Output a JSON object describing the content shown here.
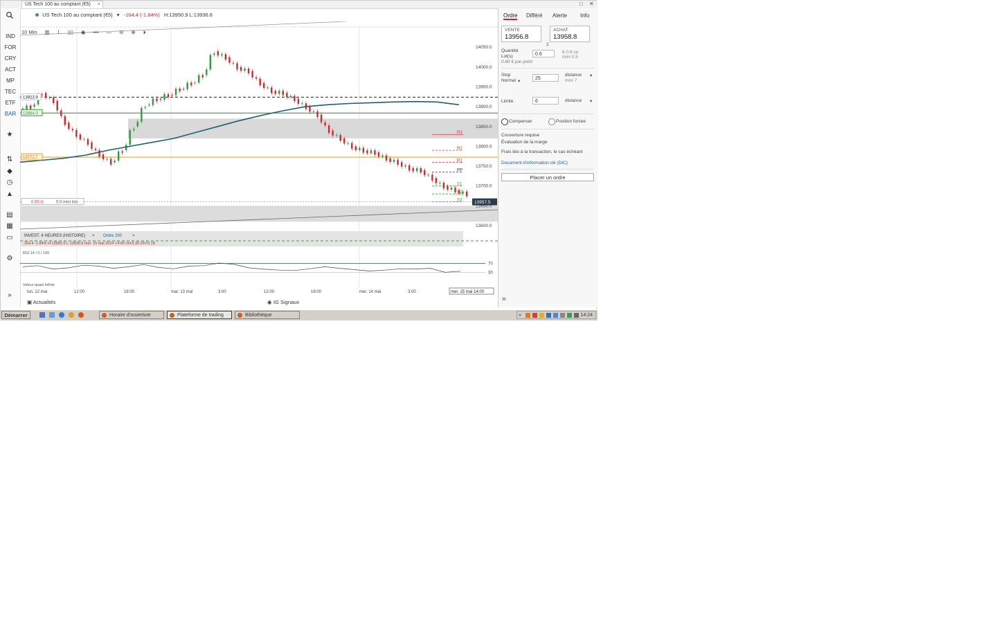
{
  "window": {
    "tab_title": "US Tech 100 au comptant (€5)",
    "tab_close": "×",
    "restore_btn": "□",
    "close_btn": "✕"
  },
  "left_nav": {
    "search_icon": "search-icon",
    "items": [
      "IND",
      "FOR",
      "CRY",
      "ACT",
      "MP",
      "TEC",
      "ETF",
      "BAR"
    ],
    "icons": [
      "star-icon",
      "arrows-icon",
      "tag-icon",
      "history-icon",
      "bell-icon",
      "archive-icon",
      "calculator-icon",
      "calendar-icon",
      "gear-icon",
      "expand-icon"
    ]
  },
  "instrument": {
    "name": "US Tech 100 au comptant (€5)",
    "change": "-164.4 (-1.84%)",
    "hilo": "H:13950.9 L:13936.6"
  },
  "chart_toolbar": {
    "timeframe": "10 Min",
    "items": [
      "10 Min",
      "bars-icon",
      "indicator-icon",
      "eye-icon",
      "more-icon",
      "line-icon",
      "zoom-out-icon",
      "zoom-in-icon",
      "play-icon"
    ]
  },
  "chart_data": [
    {
      "type": "line",
      "title": "US Tech 100 au comptant (€5) — 10 Min",
      "x_ticks": [
        "lun. 12 mai",
        "12:00",
        "18:00",
        "mar. 13 mai",
        "3:00",
        "12:00",
        "18:00",
        "mer. 14 mai",
        "3:00",
        "mer. 15 mai 14:00"
      ],
      "y_ticks": [
        14050.0,
        14000.0,
        13950.0,
        13900.0,
        13850.0,
        13800.0,
        13750.0,
        13700.0,
        13650.0,
        13600.0
      ],
      "ylim": [
        13600,
        14080
      ],
      "price_labels": {
        "upper_black_line": "13923.9",
        "green_line": "13884.0",
        "orange_line": "13772.7",
        "current": "13957.5",
        "bid_input": "0.00 G",
        "order_input": "0.0 mini lots"
      },
      "pivot_labels": [
        "R3",
        "R2",
        "R1",
        "PP",
        "S1",
        "S2",
        "S3"
      ],
      "series": [
        {
          "name": "close",
          "values": [
            13900,
            13935,
            13915,
            13860,
            13830,
            13810,
            13780,
            13760,
            13790,
            13850,
            13905,
            13920,
            13930,
            13945,
            13960,
            13980,
            14040,
            14025,
            14000,
            13990,
            13960,
            13940,
            13935,
            13920,
            13900,
            13880,
            13840,
            13820,
            13800,
            13790,
            13785,
            13770,
            13760,
            13745,
            13740,
            13720,
            13700,
            13690,
            13680
          ]
        },
        {
          "name": "MA 200",
          "values": [
            13760,
            13765,
            13770,
            13778,
            13790,
            13800,
            13810,
            13820,
            13835,
            13850,
            13865,
            13878,
            13890,
            13900,
            13905,
            13908,
            13910,
            13912,
            13913,
            13912,
            13905
          ]
        }
      ]
    },
    {
      "type": "line",
      "title": "RSI 14",
      "ylim": [
        0,
        100
      ],
      "y_ticks": [
        70,
        30
      ],
      "series": [
        {
          "name": "RSI",
          "values": [
            55,
            60,
            45,
            50,
            62,
            58,
            48,
            55,
            65,
            52,
            46,
            58,
            60,
            72,
            66,
            50,
            44,
            40,
            38,
            46,
            55,
            48,
            42,
            36,
            40,
            46,
            45,
            48,
            30,
            35
          ]
        }
      ]
    }
  ],
  "indicator_tabs": {
    "tab1": "INVEST. 4 HEURES (HISTOIRE)",
    "tab2": "Ordre 200",
    "close": "×",
    "info_line": "-164.4  -1.84%  H:13950.9  L:13936.6  mer. 15 mai 2024 14:00  Vol:5.35  DIV:0.18",
    "rsi_label": "RSI 14 / 0 / 100",
    "rsi_note": "Valeur quasi infinie"
  },
  "order_panel": {
    "tabs": [
      "Ordre",
      "Différé",
      "Alerte",
      "Info"
    ],
    "sell_label": "VENTE",
    "sell_price": "13956.8",
    "buy_label": "ACHAT",
    "buy_price": "13958.8",
    "spread": "2",
    "quantity_label": "Quantité",
    "quantity_sub": "Lot(s)",
    "quantity_value": "0.6",
    "quantity_note": "0.80 € par point",
    "quantity_right1": "€ 0.6 sa",
    "quantity_right2": "mini 0.5",
    "stop_label": "Stop",
    "stop_type": "Normal",
    "stop_value": "25",
    "stop_mode": "distance",
    "stop_min": "mini 7",
    "limit_label": "Limite",
    "limit_value": "6",
    "limit_mode": "distance",
    "radio_offset": "Compenser",
    "radio_forced": "Position forcée",
    "required_cover": "Couverture requise",
    "margin_label": "Évaluation de la marge",
    "costs_text": "Frais liés à la transaction, le cas échéant",
    "doc_link": "Document d'information clé (DIC)",
    "place_btn": "Placer un ordre",
    "collapse_icon": "double-chevron-right-icon"
  },
  "news_bar": {
    "left": "Actualités",
    "center": "IG Signaux"
  },
  "taskbar": {
    "start": "Démarrer",
    "buttons": [
      "Horaire d'ouverture",
      "Plateforme de trading",
      "Bibliothèque"
    ],
    "clock": "14:24"
  }
}
